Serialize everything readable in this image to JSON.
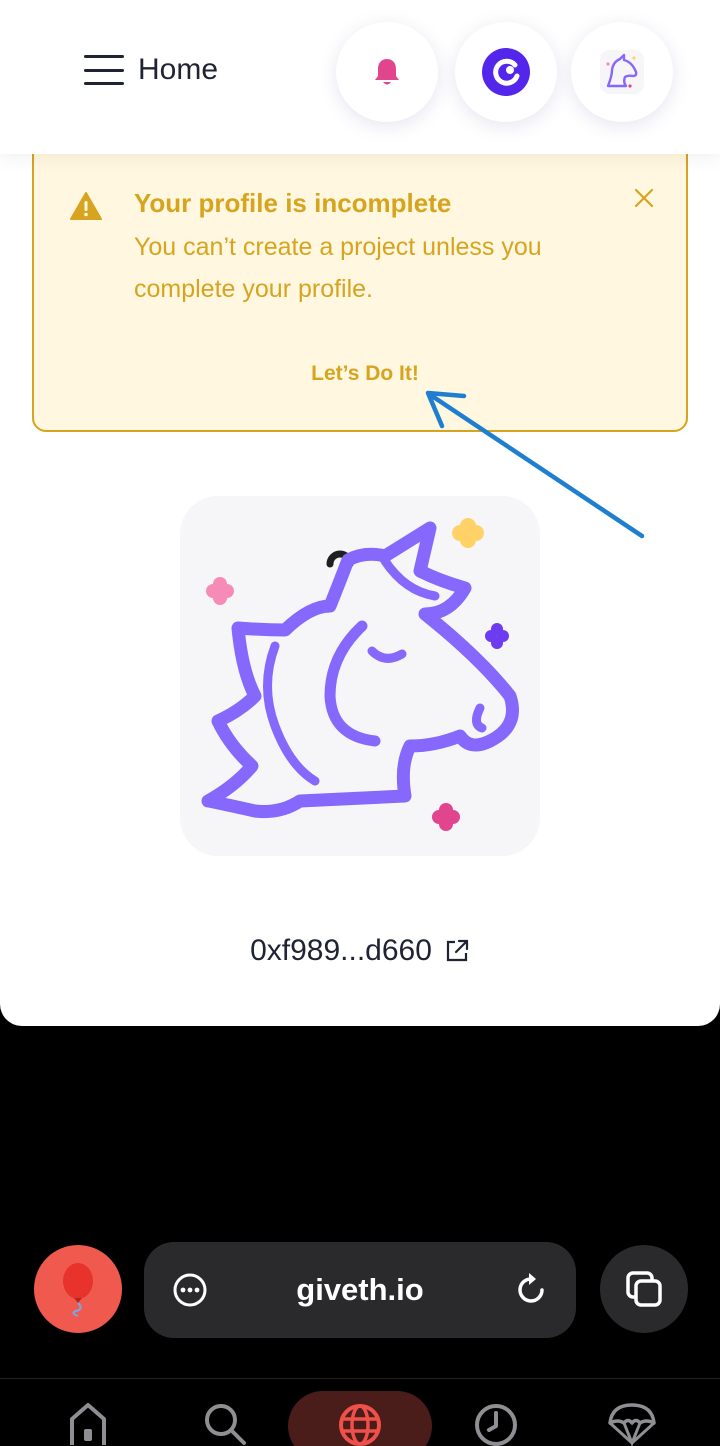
{
  "header": {
    "menu_label": "Home",
    "icons": [
      "hamburger-icon",
      "bell-icon",
      "giveth-network-icon",
      "unicorn-avatar-icon"
    ]
  },
  "banner": {
    "title": "Your profile is incomplete",
    "message": "You can’t create a project unless you complete your profile.",
    "cta_label": "Let’s Do It!",
    "color": "#d6a41f",
    "background": "#fff7e0"
  },
  "profile": {
    "wallet_address": "0xf989...d660"
  },
  "browser": {
    "url": "giveth.io"
  },
  "colors": {
    "accent_purple": "#8668fc",
    "bell_pink": "#e1458d",
    "annotation_blue": "#1e7fd0"
  }
}
